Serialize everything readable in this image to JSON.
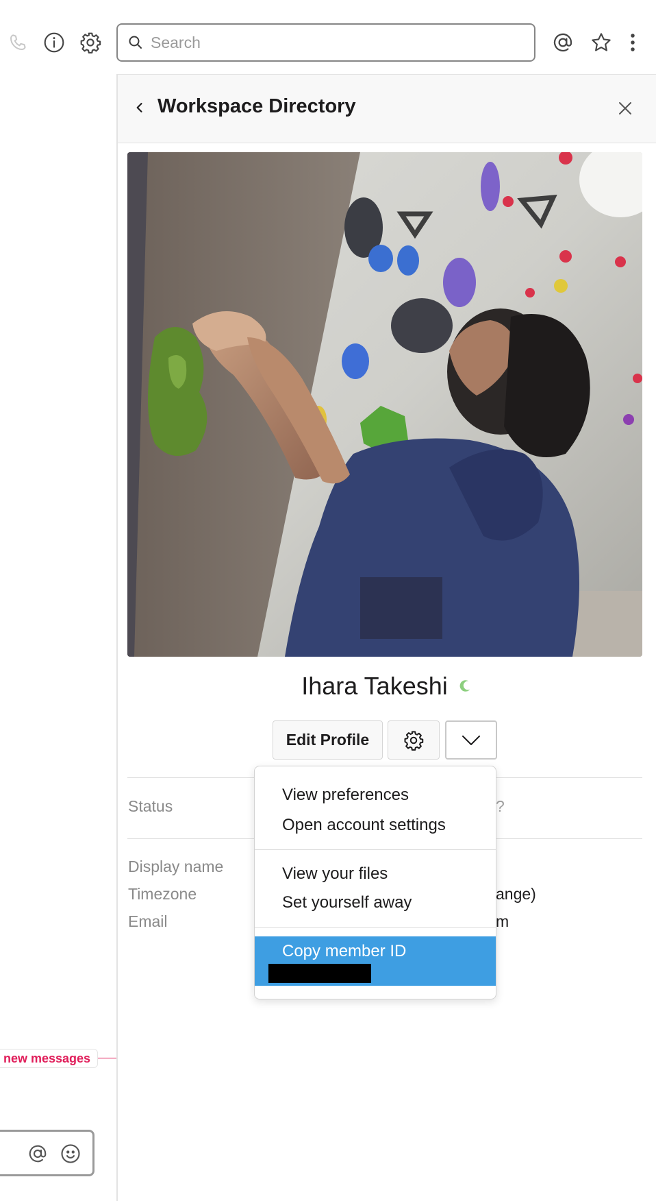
{
  "toolbar": {
    "search_placeholder": "Search",
    "icons": [
      "phone-icon",
      "info-icon",
      "gear-icon",
      "search-icon",
      "mention-icon",
      "star-icon",
      "more-vertical-icon"
    ]
  },
  "panel": {
    "title": "Workspace Directory"
  },
  "profile": {
    "name": "Ihara Takeshi",
    "presence": "away",
    "edit_profile_label": "Edit Profile"
  },
  "fields": {
    "status_label": "Status",
    "status_peek": "?",
    "display_name_label": "Display name",
    "timezone_label": "Timezone",
    "timezone_peek": "ange)",
    "email_label": "Email",
    "email_peek": "m"
  },
  "menu": {
    "items": [
      {
        "label": "View preferences"
      },
      {
        "label": "Open account settings"
      },
      {
        "label": "View your files"
      },
      {
        "label": "Set yourself away"
      },
      {
        "label": "Copy member ID"
      }
    ]
  },
  "left": {
    "new_messages_label": "new messages"
  },
  "colors": {
    "accent_highlight": "#3e9ee2",
    "new_messages": "#e01e5a",
    "presence_away": "#8ccf7e"
  }
}
